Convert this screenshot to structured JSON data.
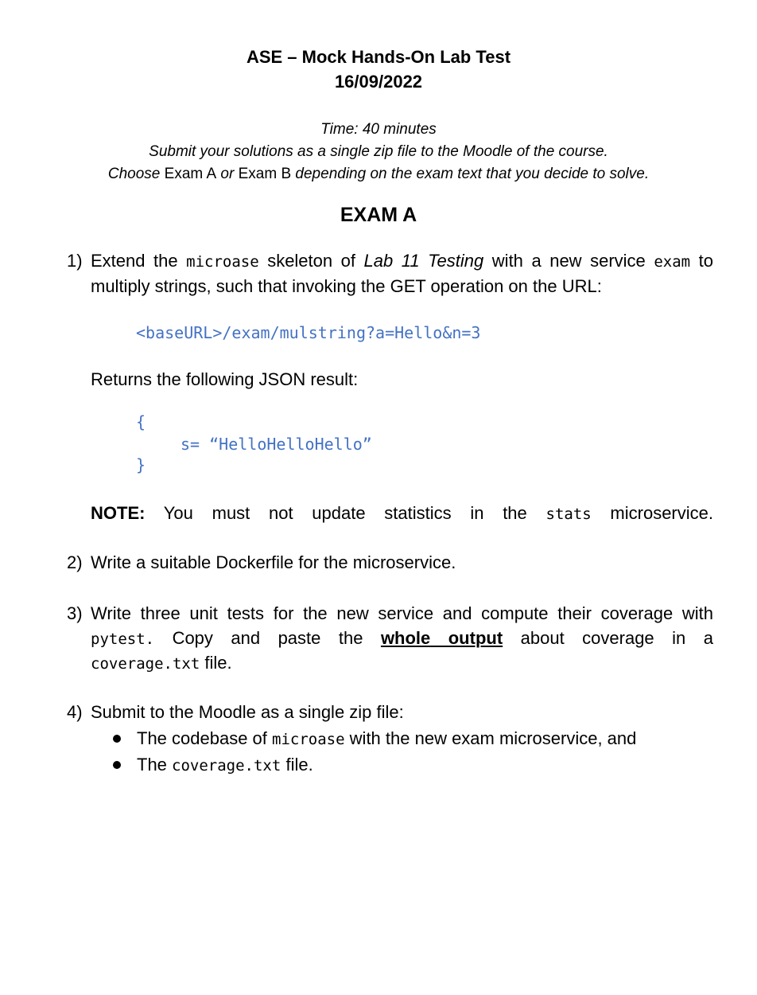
{
  "header": {
    "title": "ASE – Mock Hands-On Lab Test",
    "date": "16/09/2022"
  },
  "instructions": {
    "time": "Time: 40 minutes",
    "submit": "Submit your solutions as a single zip file to the Moodle of the course.",
    "choose_pre": "Choose",
    "exam_a": "Exam A",
    "or": "or",
    "exam_b": "Exam B",
    "choose_post": "depending on the exam text that you decide to solve."
  },
  "exam_title": "EXAM A",
  "q1": {
    "number": "1)",
    "p1": "Extend the",
    "code_microase": "microase",
    "p2": "skeleton of",
    "lab_ref": "Lab 11 Testing",
    "p3": "with a new service",
    "code_exam": "exam",
    "p4": "to",
    "line2": "multiply strings, such that invoking the GET operation on the URL:",
    "url": "<baseURL>/exam/mulstring?a=Hello&n=3",
    "returns": "Returns the following JSON result:",
    "json_open": "{",
    "json_body": "s= “HelloHelloHello”",
    "json_close": "}",
    "note_label": "NOTE:",
    "note_text": "You must not update statistics in the",
    "code_stats": "stats",
    "note_end": "microservice."
  },
  "q2": {
    "number": "2)",
    "text": "Write a suitable Dockerfile for the microservice."
  },
  "q3": {
    "number": "3)",
    "line1": "Write three unit tests for the new service and compute their coverage with",
    "code_pytest": "pytest.",
    "p1": "Copy and paste the",
    "emph": "whole output",
    "p2": "about coverage in a",
    "code_file": "coverage.txt",
    "p3": "file."
  },
  "q4": {
    "number": "4)",
    "text": "Submit to the Moodle as a single zip file:",
    "bullets": {
      "b1_pre": "The codebase of",
      "b1_code": "microase",
      "b1_post": "with the new exam microservice, and",
      "b2_pre": "The",
      "b2_code": "coverage.txt",
      "b2_post": "file."
    }
  }
}
